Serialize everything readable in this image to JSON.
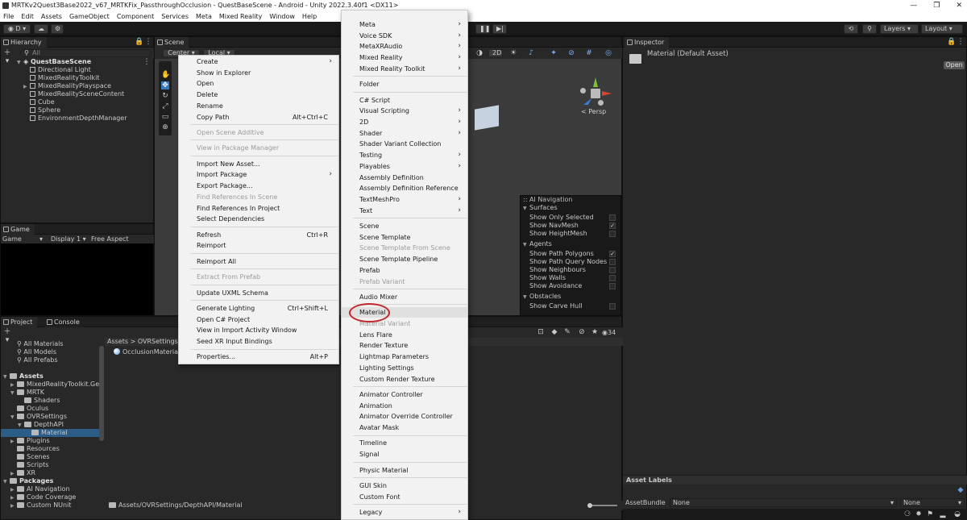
{
  "window": {
    "title": "MRTKv2Quest3Base2022_v67_MRTKFix_PassthroughOcclusion - QuestBaseScene - Android - Unity 2022.3.40f1 <DX11>",
    "controls": [
      "—",
      "❐",
      "✕"
    ]
  },
  "menubar": [
    "File",
    "Edit",
    "Assets",
    "GameObject",
    "Component",
    "Services",
    "Meta",
    "Mixed Reality",
    "Window",
    "Help"
  ],
  "toolbar": {
    "account": "D",
    "layers": "Layers",
    "layout": "Layout"
  },
  "hierarchy": {
    "tab": "Hierarchy",
    "search_placeholder": "All",
    "scene": "QuestBaseScene",
    "items": [
      "Directional Light",
      "MixedRealityToolkit",
      "MixedRealityPlayspace",
      "MixedRealitySceneContent",
      "Cube",
      "Sphere",
      "EnvironmentDepthManager"
    ]
  },
  "scene": {
    "tab": "Scene",
    "pivot": "Center",
    "space": "Local",
    "mode2d": "2D",
    "persp": "Persp"
  },
  "game": {
    "tab": "Game",
    "display_type": "Game",
    "display": "Display 1",
    "aspect": "Free Aspect"
  },
  "inspector": {
    "tab": "Inspector",
    "title": "Material (Default Asset)",
    "open_button": "Open",
    "asset_labels": "Asset Labels",
    "assetbundle_label": "AssetBundle",
    "assetbundle_value": "None",
    "assetbundle_variant": "None"
  },
  "project": {
    "tab": "Project",
    "console_tab": "Console",
    "breadcrumb": [
      "Assets",
      "OVRSettings"
    ],
    "favorites": [
      "All Materials",
      "All Models",
      "All Prefabs"
    ],
    "tree": [
      {
        "label": "Assets",
        "level": 0,
        "bold": true
      },
      {
        "label": "MixedRealityToolkit.Gene",
        "level": 1
      },
      {
        "label": "MRTK",
        "level": 1
      },
      {
        "label": "Shaders",
        "level": 2
      },
      {
        "label": "Oculus",
        "level": 1
      },
      {
        "label": "OVRSettings",
        "level": 1
      },
      {
        "label": "DepthAPI",
        "level": 2
      },
      {
        "label": "Material",
        "level": 3
      },
      {
        "label": "Plugins",
        "level": 1
      },
      {
        "label": "Resources",
        "level": 1
      },
      {
        "label": "Scenes",
        "level": 1
      },
      {
        "label": "Scripts",
        "level": 1
      },
      {
        "label": "XR",
        "level": 1
      },
      {
        "label": "Packages",
        "level": 0,
        "bold": true
      },
      {
        "label": "AI Navigation",
        "level": 1
      },
      {
        "label": "Code Coverage",
        "level": 1
      },
      {
        "label": "Custom NUnit",
        "level": 1
      }
    ],
    "file": "OcclusionMaterial",
    "path": "Assets/OVRSettings/DepthAPI/Material",
    "count": "34"
  },
  "context_menu": [
    {
      "label": "Create",
      "arrow": true
    },
    {
      "label": "Show in Explorer"
    },
    {
      "label": "Open"
    },
    {
      "label": "Delete"
    },
    {
      "label": "Rename"
    },
    {
      "label": "Copy Path",
      "shortcut": "Alt+Ctrl+C"
    },
    {
      "sep": true
    },
    {
      "label": "Open Scene Additive",
      "disabled": true
    },
    {
      "sep": true
    },
    {
      "label": "View in Package Manager",
      "disabled": true
    },
    {
      "sep": true
    },
    {
      "label": "Import New Asset..."
    },
    {
      "label": "Import Package",
      "arrow": true
    },
    {
      "label": "Export Package..."
    },
    {
      "label": "Find References In Scene",
      "disabled": true
    },
    {
      "label": "Find References In Project"
    },
    {
      "label": "Select Dependencies"
    },
    {
      "sep": true
    },
    {
      "label": "Refresh",
      "shortcut": "Ctrl+R"
    },
    {
      "label": "Reimport"
    },
    {
      "sep": true
    },
    {
      "label": "Reimport All"
    },
    {
      "sep": true
    },
    {
      "label": "Extract From Prefab",
      "disabled": true
    },
    {
      "sep": true
    },
    {
      "label": "Update UXML Schema"
    },
    {
      "sep": true
    },
    {
      "label": "Generate Lighting",
      "shortcut": "Ctrl+Shift+L"
    },
    {
      "label": "Open C# Project"
    },
    {
      "label": "View in Import Activity Window"
    },
    {
      "label": "Seed XR Input Bindings"
    },
    {
      "sep": true
    },
    {
      "label": "Properties...",
      "shortcut": "Alt+P"
    }
  ],
  "create_menu": [
    {
      "label": "Meta",
      "arrow": true
    },
    {
      "label": "Voice SDK",
      "arrow": true
    },
    {
      "label": "MetaXRAudio",
      "arrow": true
    },
    {
      "label": "Mixed Reality",
      "arrow": true
    },
    {
      "label": "Mixed Reality Toolkit",
      "arrow": true
    },
    {
      "sep": true
    },
    {
      "label": "Folder"
    },
    {
      "sep": true
    },
    {
      "label": "C# Script"
    },
    {
      "label": "Visual Scripting",
      "arrow": true
    },
    {
      "label": "2D",
      "arrow": true
    },
    {
      "label": "Shader",
      "arrow": true
    },
    {
      "label": "Shader Variant Collection"
    },
    {
      "label": "Testing",
      "arrow": true
    },
    {
      "label": "Playables",
      "arrow": true
    },
    {
      "label": "Assembly Definition"
    },
    {
      "label": "Assembly Definition Reference"
    },
    {
      "label": "TextMeshPro",
      "arrow": true
    },
    {
      "label": "Text",
      "arrow": true
    },
    {
      "sep": true
    },
    {
      "label": "Scene"
    },
    {
      "label": "Scene Template"
    },
    {
      "label": "Scene Template From Scene",
      "disabled": true
    },
    {
      "label": "Scene Template Pipeline"
    },
    {
      "label": "Prefab"
    },
    {
      "label": "Prefab Variant",
      "disabled": true
    },
    {
      "sep": true
    },
    {
      "label": "Audio Mixer"
    },
    {
      "sep": true
    },
    {
      "label": "Material",
      "highlight": true
    },
    {
      "label": "Material Variant",
      "disabled": true
    },
    {
      "label": "Lens Flare"
    },
    {
      "label": "Render Texture"
    },
    {
      "label": "Lightmap Parameters"
    },
    {
      "label": "Lighting Settings"
    },
    {
      "label": "Custom Render Texture"
    },
    {
      "sep": true
    },
    {
      "label": "Animator Controller"
    },
    {
      "label": "Animation"
    },
    {
      "label": "Animator Override Controller"
    },
    {
      "label": "Avatar Mask"
    },
    {
      "sep": true
    },
    {
      "label": "Timeline"
    },
    {
      "label": "Signal"
    },
    {
      "sep": true
    },
    {
      "label": "Physic Material"
    },
    {
      "sep": true
    },
    {
      "label": "GUI Skin"
    },
    {
      "label": "Custom Font"
    },
    {
      "sep": true
    },
    {
      "label": "Legacy",
      "arrow": true
    }
  ],
  "ai_navigation": {
    "title": "AI Navigation",
    "sections": [
      {
        "name": "Surfaces",
        "items": [
          {
            "label": "Show Only Selected",
            "checked": false
          },
          {
            "label": "Show NavMesh",
            "checked": true
          },
          {
            "label": "Show HeightMesh",
            "checked": false
          }
        ]
      },
      {
        "name": "Agents",
        "items": [
          {
            "label": "Show Path Polygons",
            "checked": true
          },
          {
            "label": "Show Path Query Nodes",
            "checked": false
          },
          {
            "label": "Show Neighbours",
            "checked": false
          },
          {
            "label": "Show Walls",
            "checked": false
          },
          {
            "label": "Show Avoidance",
            "checked": false
          }
        ]
      },
      {
        "name": "Obstacles",
        "items": [
          {
            "label": "Show Carve Hull",
            "checked": false
          }
        ]
      }
    ]
  },
  "icons": {
    "gizmo_colors": {
      "x": "#d8452f",
      "y": "#7ac13e",
      "z": "#3a7cd8"
    },
    "highlight_circle": "#c0262c",
    "accent": "#3a79bb"
  }
}
